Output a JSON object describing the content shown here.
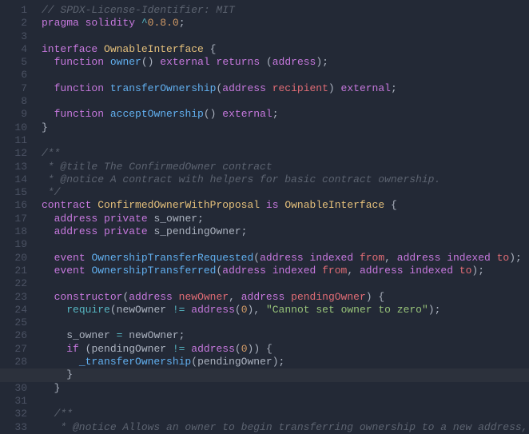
{
  "gutter": {
    "start": 1,
    "end": 33
  },
  "highlight_line": 29,
  "lines": [
    [
      [
        "c-comment",
        "// SPDX-License-Identifier: MIT"
      ]
    ],
    [
      [
        "c-keyword",
        "pragma"
      ],
      [
        "c-plain",
        " "
      ],
      [
        "c-keyword",
        "solidity"
      ],
      [
        "c-plain",
        " "
      ],
      [
        "c-op",
        "^"
      ],
      [
        "c-num",
        "0.8.0"
      ],
      [
        "c-punc",
        ";"
      ]
    ],
    [],
    [
      [
        "c-keyword",
        "interface"
      ],
      [
        "c-plain",
        " "
      ],
      [
        "c-ident",
        "OwnableInterface"
      ],
      [
        "c-plain",
        " "
      ],
      [
        "c-punc",
        "{"
      ]
    ],
    [
      [
        "c-indent",
        "· "
      ],
      [
        "c-keyword",
        "function"
      ],
      [
        "c-plain",
        " "
      ],
      [
        "c-func",
        "owner"
      ],
      [
        "c-punc",
        "()"
      ],
      [
        "c-plain",
        " "
      ],
      [
        "c-keyword",
        "external"
      ],
      [
        "c-plain",
        " "
      ],
      [
        "c-keyword",
        "returns"
      ],
      [
        "c-plain",
        " "
      ],
      [
        "c-punc",
        "("
      ],
      [
        "c-type",
        "address"
      ],
      [
        "c-punc",
        ")"
      ],
      [
        "c-punc",
        ";"
      ]
    ],
    [],
    [
      [
        "c-indent",
        "· "
      ],
      [
        "c-keyword",
        "function"
      ],
      [
        "c-plain",
        " "
      ],
      [
        "c-func",
        "transferOwnership"
      ],
      [
        "c-punc",
        "("
      ],
      [
        "c-type",
        "address"
      ],
      [
        "c-plain",
        " "
      ],
      [
        "c-param",
        "recipient"
      ],
      [
        "c-punc",
        ")"
      ],
      [
        "c-plain",
        " "
      ],
      [
        "c-keyword",
        "external"
      ],
      [
        "c-punc",
        ";"
      ]
    ],
    [],
    [
      [
        "c-indent",
        "· "
      ],
      [
        "c-keyword",
        "function"
      ],
      [
        "c-plain",
        " "
      ],
      [
        "c-func",
        "acceptOwnership"
      ],
      [
        "c-punc",
        "()"
      ],
      [
        "c-plain",
        " "
      ],
      [
        "c-keyword",
        "external"
      ],
      [
        "c-punc",
        ";"
      ]
    ],
    [
      [
        "c-punc",
        "}"
      ]
    ],
    [],
    [
      [
        "c-comment",
        "/**"
      ]
    ],
    [
      [
        "c-comment",
        " * @title The ConfirmedOwner contract"
      ]
    ],
    [
      [
        "c-comment",
        " * @notice A contract with helpers for basic contract ownership."
      ]
    ],
    [
      [
        "c-comment",
        " */"
      ]
    ],
    [
      [
        "c-keyword",
        "contract"
      ],
      [
        "c-plain",
        " "
      ],
      [
        "c-ident",
        "ConfirmedOwnerWithProposal"
      ],
      [
        "c-plain",
        " "
      ],
      [
        "c-keyword",
        "is"
      ],
      [
        "c-plain",
        " "
      ],
      [
        "c-ident",
        "OwnableInterface"
      ],
      [
        "c-plain",
        " "
      ],
      [
        "c-punc",
        "{"
      ]
    ],
    [
      [
        "c-indent",
        "· "
      ],
      [
        "c-type",
        "address"
      ],
      [
        "c-plain",
        " "
      ],
      [
        "c-keyword",
        "private"
      ],
      [
        "c-plain",
        " "
      ],
      [
        "c-plain",
        "s_owner"
      ],
      [
        "c-punc",
        ";"
      ]
    ],
    [
      [
        "c-indent",
        "· "
      ],
      [
        "c-type",
        "address"
      ],
      [
        "c-plain",
        " "
      ],
      [
        "c-keyword",
        "private"
      ],
      [
        "c-plain",
        " "
      ],
      [
        "c-plain",
        "s_pendingOwner"
      ],
      [
        "c-punc",
        ";"
      ]
    ],
    [],
    [
      [
        "c-indent",
        "· "
      ],
      [
        "c-keyword",
        "event"
      ],
      [
        "c-plain",
        " "
      ],
      [
        "c-func",
        "OwnershipTransferRequested"
      ],
      [
        "c-punc",
        "("
      ],
      [
        "c-type",
        "address"
      ],
      [
        "c-plain",
        " "
      ],
      [
        "c-keyword",
        "indexed"
      ],
      [
        "c-plain",
        " "
      ],
      [
        "c-param",
        "from"
      ],
      [
        "c-punc",
        ","
      ],
      [
        "c-plain",
        " "
      ],
      [
        "c-type",
        "address"
      ],
      [
        "c-plain",
        " "
      ],
      [
        "c-keyword",
        "indexed"
      ],
      [
        "c-plain",
        " "
      ],
      [
        "c-param",
        "to"
      ],
      [
        "c-punc",
        ")"
      ],
      [
        "c-punc",
        ";"
      ]
    ],
    [
      [
        "c-indent",
        "· "
      ],
      [
        "c-keyword",
        "event"
      ],
      [
        "c-plain",
        " "
      ],
      [
        "c-func",
        "OwnershipTransferred"
      ],
      [
        "c-punc",
        "("
      ],
      [
        "c-type",
        "address"
      ],
      [
        "c-plain",
        " "
      ],
      [
        "c-keyword",
        "indexed"
      ],
      [
        "c-plain",
        " "
      ],
      [
        "c-param",
        "from"
      ],
      [
        "c-punc",
        ","
      ],
      [
        "c-plain",
        " "
      ],
      [
        "c-type",
        "address"
      ],
      [
        "c-plain",
        " "
      ],
      [
        "c-keyword",
        "indexed"
      ],
      [
        "c-plain",
        " "
      ],
      [
        "c-param",
        "to"
      ],
      [
        "c-punc",
        ")"
      ],
      [
        "c-punc",
        ";"
      ]
    ],
    [],
    [
      [
        "c-indent",
        "· "
      ],
      [
        "c-keyword",
        "constructor"
      ],
      [
        "c-punc",
        "("
      ],
      [
        "c-type",
        "address"
      ],
      [
        "c-plain",
        " "
      ],
      [
        "c-param",
        "newOwner"
      ],
      [
        "c-punc",
        ","
      ],
      [
        "c-plain",
        " "
      ],
      [
        "c-type",
        "address"
      ],
      [
        "c-plain",
        " "
      ],
      [
        "c-param",
        "pendingOwner"
      ],
      [
        "c-punc",
        ")"
      ],
      [
        "c-plain",
        " "
      ],
      [
        "c-punc",
        "{"
      ]
    ],
    [
      [
        "c-indent",
        "· · "
      ],
      [
        "c-builtin",
        "require"
      ],
      [
        "c-punc",
        "("
      ],
      [
        "c-plain",
        "newOwner "
      ],
      [
        "c-op",
        "!="
      ],
      [
        "c-plain",
        " "
      ],
      [
        "c-type",
        "address"
      ],
      [
        "c-punc",
        "("
      ],
      [
        "c-num",
        "0"
      ],
      [
        "c-punc",
        ")"
      ],
      [
        "c-punc",
        ","
      ],
      [
        "c-plain",
        " "
      ],
      [
        "c-string",
        "\"Cannot set owner to zero\""
      ],
      [
        "c-punc",
        ")"
      ],
      [
        "c-punc",
        ";"
      ]
    ],
    [],
    [
      [
        "c-indent",
        "· · "
      ],
      [
        "c-plain",
        "s_owner "
      ],
      [
        "c-op",
        "="
      ],
      [
        "c-plain",
        " newOwner"
      ],
      [
        "c-punc",
        ";"
      ]
    ],
    [
      [
        "c-indent",
        "· · "
      ],
      [
        "c-keyword",
        "if"
      ],
      [
        "c-plain",
        " "
      ],
      [
        "c-punc",
        "("
      ],
      [
        "c-plain",
        "pendingOwner "
      ],
      [
        "c-op",
        "!="
      ],
      [
        "c-plain",
        " "
      ],
      [
        "c-type",
        "address"
      ],
      [
        "c-punc",
        "("
      ],
      [
        "c-num",
        "0"
      ],
      [
        "c-punc",
        ")"
      ],
      [
        "c-punc",
        ")"
      ],
      [
        "c-plain",
        " "
      ],
      [
        "c-punc",
        "{"
      ]
    ],
    [
      [
        "c-indent",
        "· · · "
      ],
      [
        "c-func",
        "_transferOwnership"
      ],
      [
        "c-punc",
        "("
      ],
      [
        "c-plain",
        "pendingOwner"
      ],
      [
        "c-punc",
        ")"
      ],
      [
        "c-punc",
        ";"
      ]
    ],
    [
      [
        "c-indent",
        "· · "
      ],
      [
        "c-punc",
        "}"
      ]
    ],
    [
      [
        "c-indent",
        "· "
      ],
      [
        "c-punc",
        "}"
      ]
    ],
    [],
    [
      [
        "c-indent",
        "· "
      ],
      [
        "c-comment",
        "/**"
      ]
    ],
    [
      [
        "c-indent",
        "·  "
      ],
      [
        "c-comment",
        "* @notice Allows an owner to begin transferring ownership to a new address,"
      ]
    ]
  ]
}
